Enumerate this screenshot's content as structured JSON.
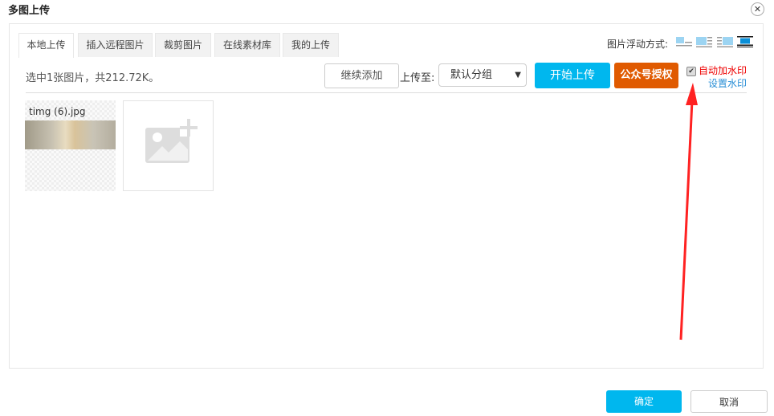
{
  "dialog": {
    "title": "多图上传"
  },
  "tabs": [
    {
      "label": "本地上传",
      "active": true
    },
    {
      "label": "插入远程图片"
    },
    {
      "label": "裁剪图片"
    },
    {
      "label": "在线素材库"
    },
    {
      "label": "我的上传"
    }
  ],
  "float": {
    "label": "图片浮动方式:",
    "options": [
      "float-left",
      "float-right",
      "float-none",
      "center"
    ],
    "selected": "center"
  },
  "toolbar": {
    "status": "选中1张图片，共212.72K。",
    "add_more": "继续添加",
    "upload_to": "上传至:",
    "group": "默认分组",
    "start": "开始上传",
    "auth": "公众号授权",
    "auto_watermark": "自动加水印",
    "auto_watermark_checked": true,
    "set_watermark": "设置水印"
  },
  "files": [
    {
      "name": "timg (6).jpg"
    }
  ],
  "footer": {
    "ok": "确定",
    "cancel": "取消"
  },
  "colors": {
    "primary": "#00b7ee",
    "auth": "#e05a00",
    "annotation": "#ff2222"
  }
}
